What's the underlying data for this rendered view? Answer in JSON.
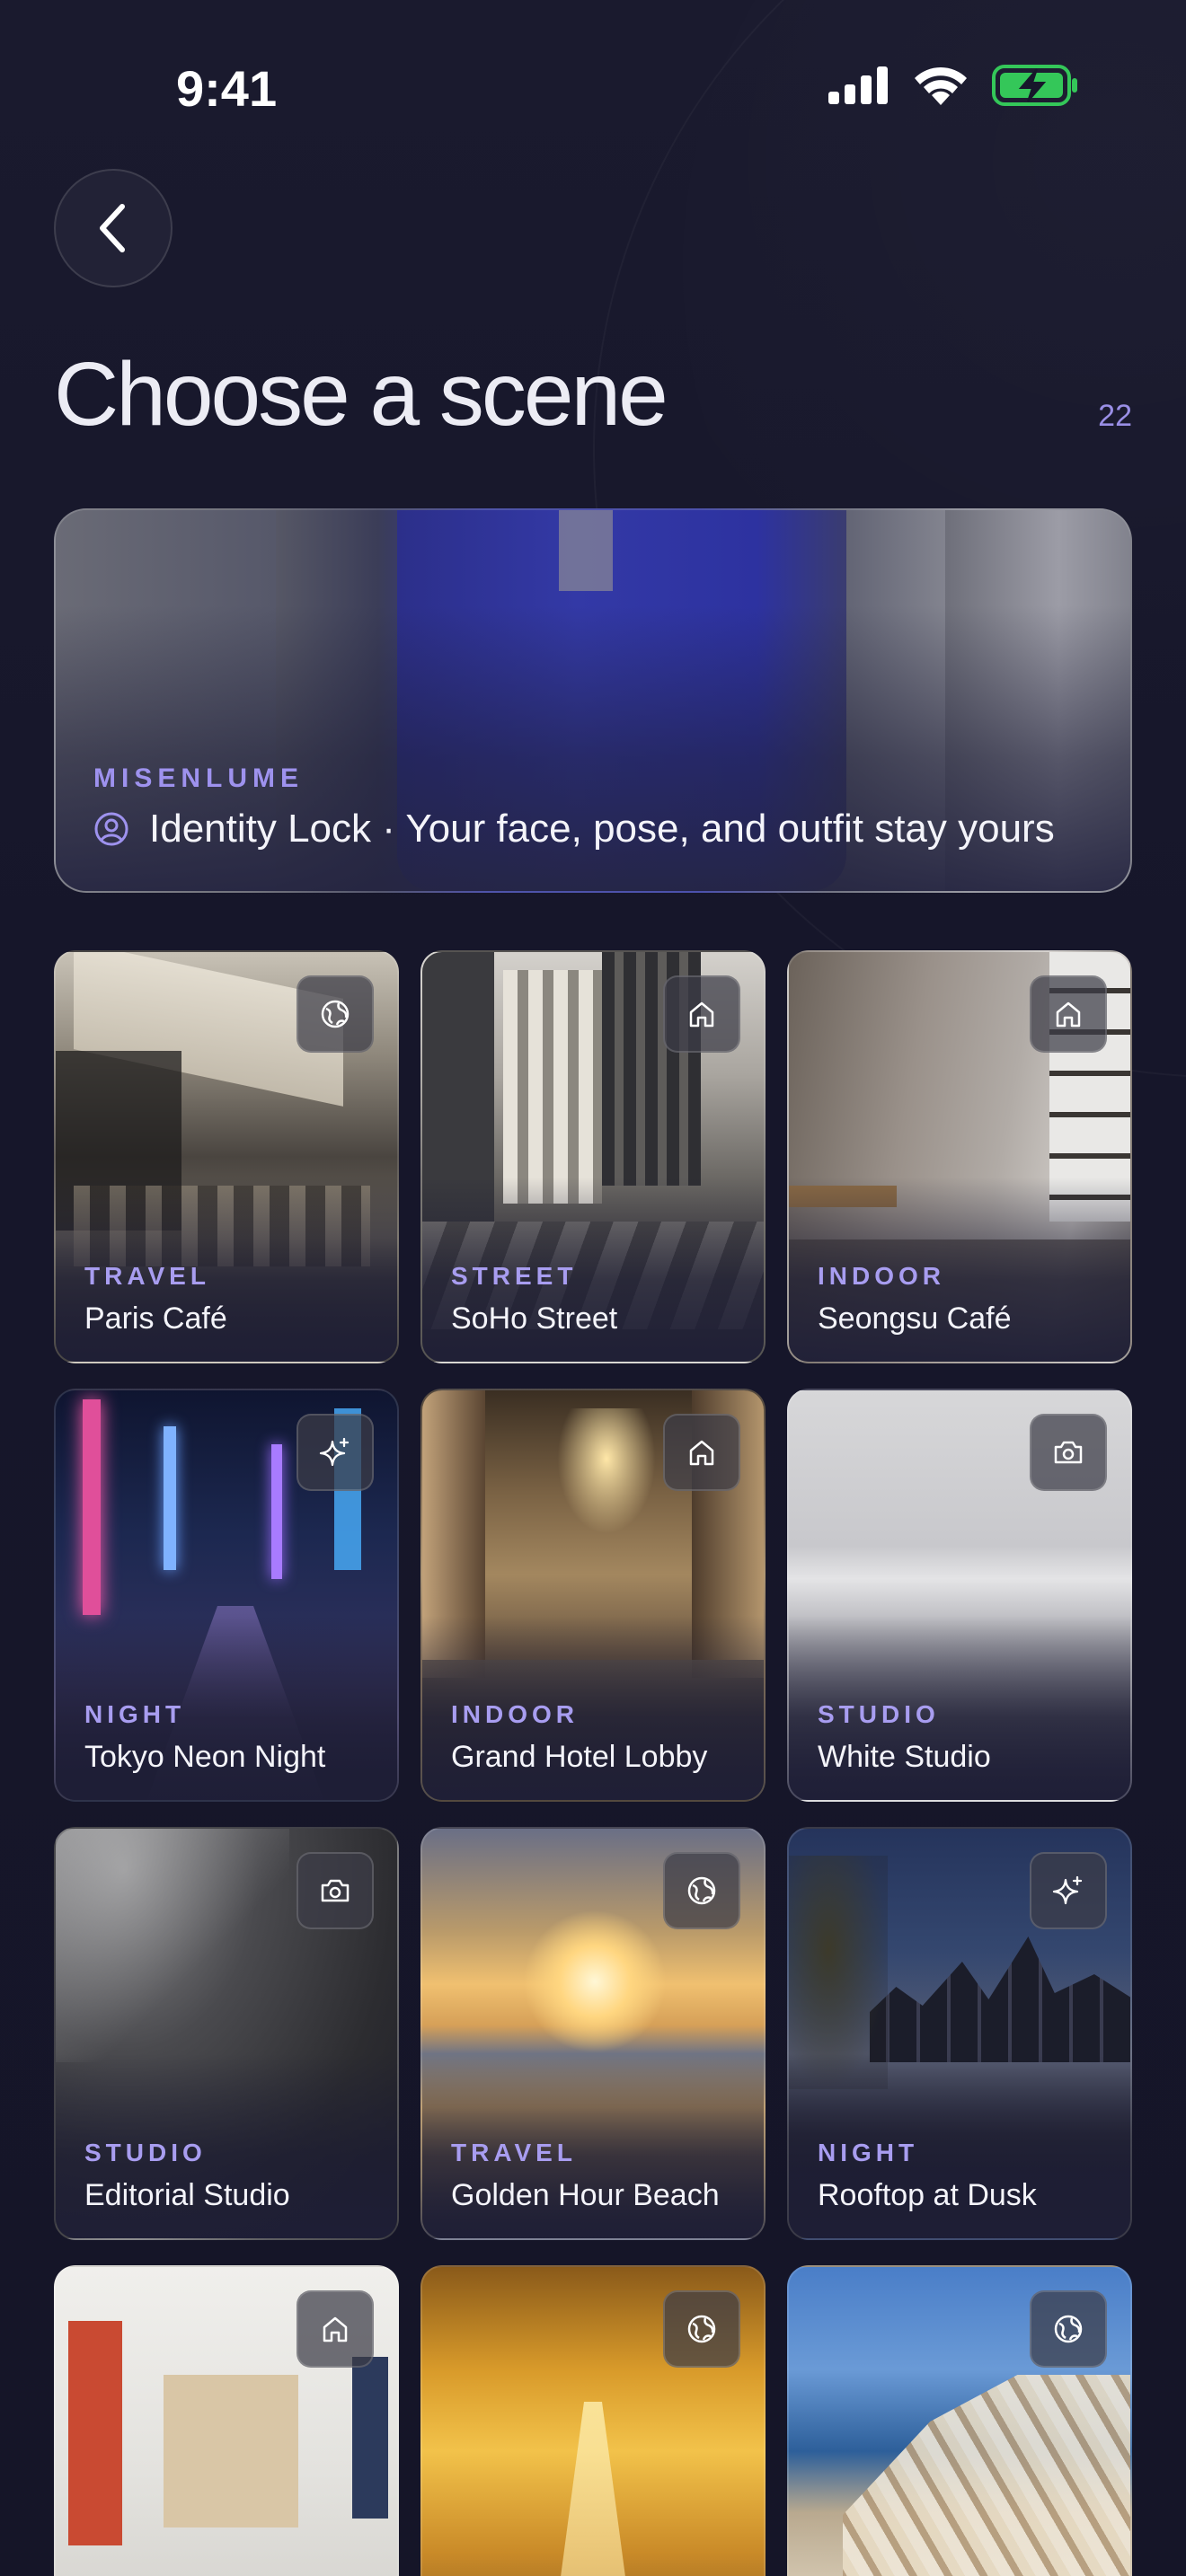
{
  "status_bar": {
    "time": "9:41"
  },
  "header": {
    "back_label": "Back",
    "title": "Choose a scene",
    "count": "22"
  },
  "hero": {
    "brand": "MISENLUME",
    "text": "Identity Lock · Your face, pose, and outfit stay yours",
    "icon": "user-circle-icon"
  },
  "scenes": [
    {
      "category": "TRAVEL",
      "name": "Paris Café",
      "icon": "globe-icon"
    },
    {
      "category": "STREET",
      "name": "SoHo Street",
      "icon": "home-icon"
    },
    {
      "category": "INDOOR",
      "name": "Seongsu Café",
      "icon": "home-icon"
    },
    {
      "category": "NIGHT",
      "name": "Tokyo Neon Night",
      "icon": "sparkle-icon"
    },
    {
      "category": "INDOOR",
      "name": "Grand Hotel Lobby",
      "icon": "home-icon"
    },
    {
      "category": "STUDIO",
      "name": "White Studio",
      "icon": "camera-icon"
    },
    {
      "category": "STUDIO",
      "name": "Editorial Studio",
      "icon": "camera-icon"
    },
    {
      "category": "TRAVEL",
      "name": "Golden Hour Beach",
      "icon": "globe-icon"
    },
    {
      "category": "NIGHT",
      "name": "Rooftop at Dusk",
      "icon": "sparkle-icon"
    },
    {
      "category": "",
      "name": "",
      "icon": "home-icon"
    },
    {
      "category": "",
      "name": "",
      "icon": "globe-icon"
    },
    {
      "category": "",
      "name": "",
      "icon": "globe-icon"
    }
  ],
  "colors": {
    "accent": "#9e92ee",
    "background": "#17172b",
    "battery": "#34c759"
  }
}
